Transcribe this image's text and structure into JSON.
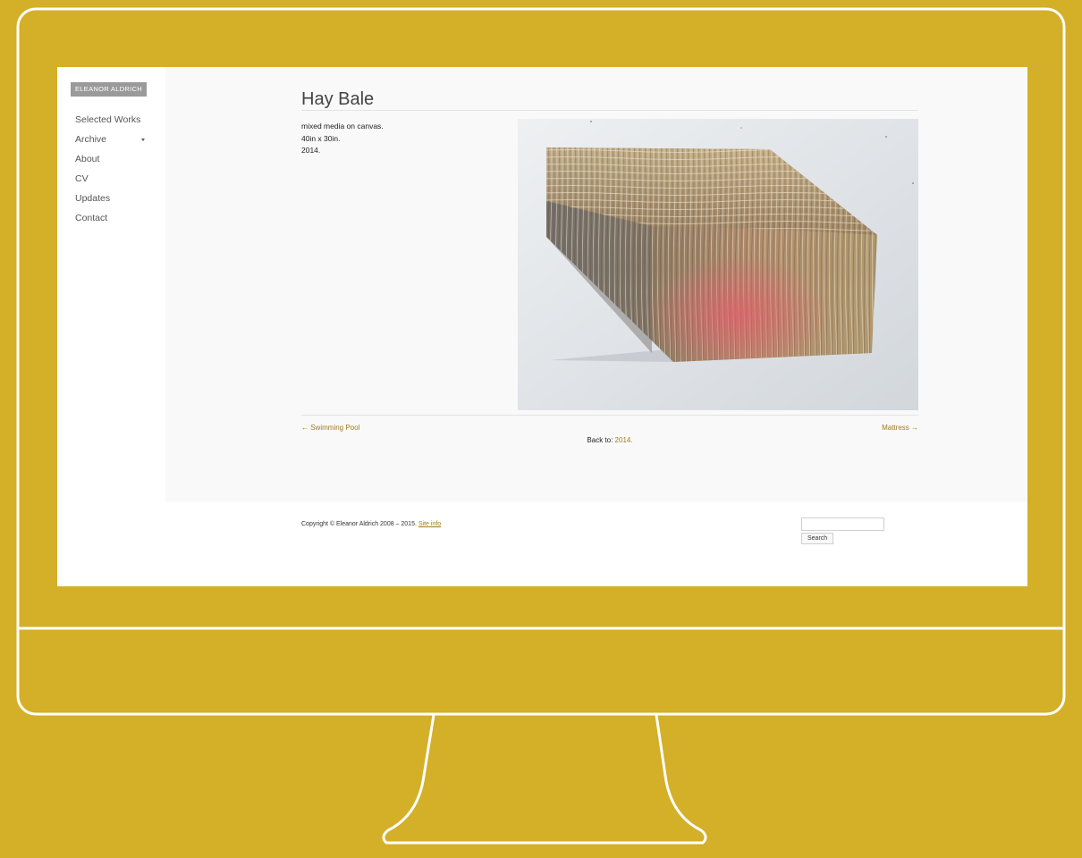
{
  "colors": {
    "background": "#d4af28",
    "monitor_outline": "#ffffff",
    "link": "#a07a20",
    "logo_bg": "#9a9a9a",
    "content_bg": "#f9f9f9"
  },
  "site": {
    "logo_text": "ELEANOR ALDRICH"
  },
  "sidebar": {
    "items": [
      {
        "label": "Selected Works"
      },
      {
        "label": "Archive",
        "icon": "caret-down-icon"
      },
      {
        "label": "About"
      },
      {
        "label": "CV"
      },
      {
        "label": "Updates"
      },
      {
        "label": "Contact"
      }
    ]
  },
  "artwork": {
    "title": "Hay Bale",
    "medium": "mixed media on canvas.",
    "dimensions": "40in x 30in.",
    "year": "2014."
  },
  "post_nav": {
    "prev_label": "← Swimming Pool",
    "next_label": "Mattress →",
    "back_prefix": "Back to:",
    "back_link": "2014."
  },
  "footer": {
    "copyright_text": "Copyright © Eleanor Aldrich 2008 – 2015.",
    "site_info_link": "Site info",
    "search_button": "Search",
    "search_value": ""
  }
}
